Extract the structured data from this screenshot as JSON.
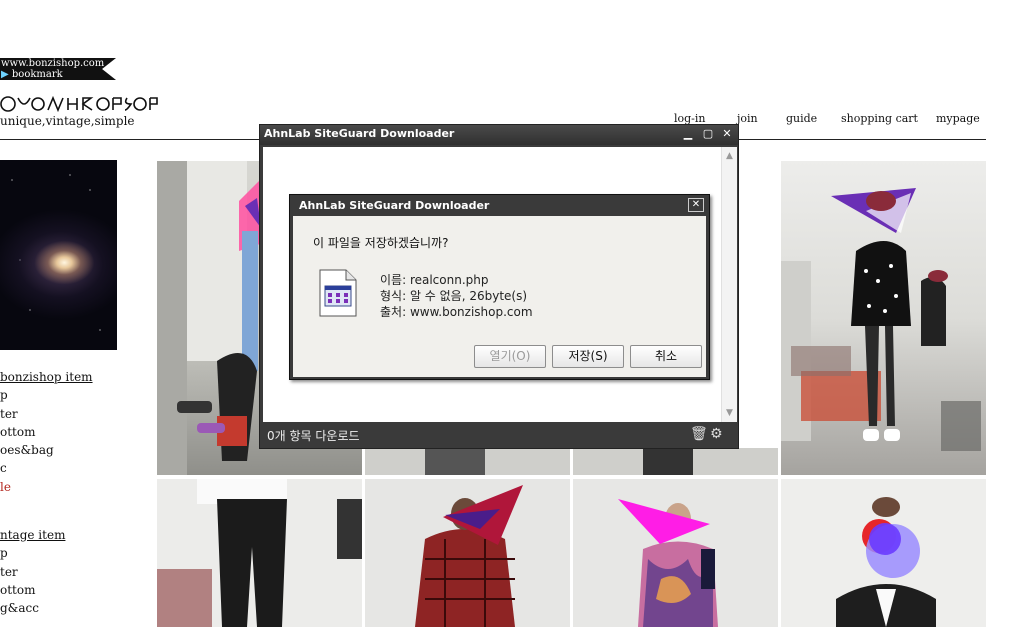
{
  "shop": {
    "site_url": "www.bonzishop.com",
    "bookmark": "bookmark",
    "tagline": "unique,vintage,simple",
    "nav": [
      "log-in",
      "join",
      "guide",
      "shopping cart",
      "mypage"
    ],
    "bonzishop_items": {
      "header": "bonzishop item",
      "items": [
        "p",
        "ter",
        "ottom",
        "oes&bag",
        "c",
        "le"
      ]
    },
    "vintage_items": {
      "header": "ntage item",
      "items": [
        "p",
        "ter",
        "ottom",
        "g&acc"
      ]
    }
  },
  "downloader": {
    "title": "AhnLab SiteGuard Downloader",
    "minimize_icon": "minimize-icon",
    "maximize_icon": "maximize-icon",
    "close_icon": "close-icon",
    "status_text": "0개 항목 다운로드",
    "trash_icon": "trash-icon",
    "settings_icon": "gear-icon"
  },
  "save_dialog": {
    "title": "AhnLab SiteGuard Downloader",
    "question": "이 파일을 저장하겠습니까?",
    "name_line": "이름: realconn.php",
    "type_line": "형식: 알 수 없음, 26byte(s)",
    "source_line": "출처: www.bonzishop.com",
    "buttons": {
      "open": "열기(O)",
      "save": "저장(S)",
      "cancel": "취소"
    }
  },
  "colors": {
    "window_chrome": "#3b3b3b",
    "dialog_face": "#f1f0ec",
    "sale_red": "#b3261e",
    "overlay_magenta": "#ff1de6",
    "overlay_purple": "#6a2fb5"
  }
}
